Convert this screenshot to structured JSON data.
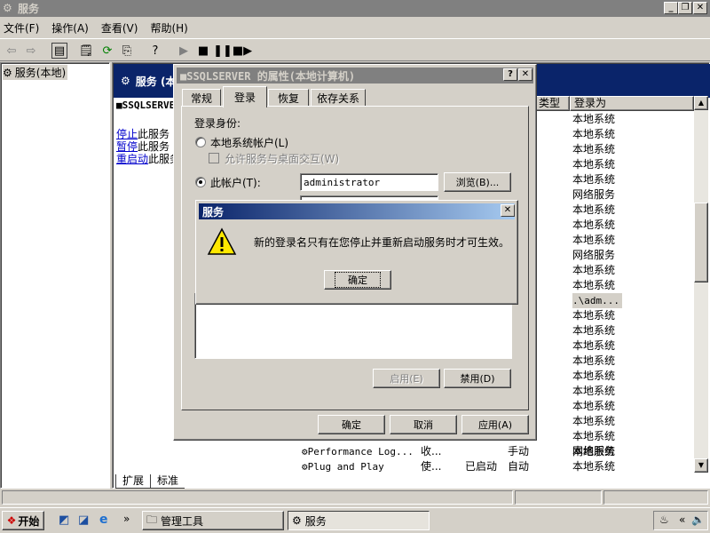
{
  "window": {
    "title": "服务"
  },
  "menu": [
    "文件(F)",
    "操作(A)",
    "查看(V)",
    "帮助(H)"
  ],
  "tree": {
    "root": "服务(本地)"
  },
  "services_header": {
    "title": "服务 (本地)"
  },
  "left_info": {
    "service_name": "■SSQLSERVER",
    "stop_link": "停止",
    "stop_rest": "此服务",
    "pause_link": "暂停",
    "pause_rest": "此服务",
    "restart_link": "重启动",
    "restart_rest": "此服务"
  },
  "columns": {
    "type": "类型",
    "logon": "登录为"
  },
  "logon_values": [
    "本地系统",
    "本地系统",
    "本地系统",
    "本地系统",
    "本地系统",
    "网络服务",
    "本地系统",
    "本地系统",
    "本地系统",
    "网络服务",
    "本地系统",
    "本地系统",
    ".\\adm...",
    "本地系统",
    "本地系统",
    "本地系统",
    "本地系统",
    "本地系统",
    "本地系统",
    "本地系统",
    "本地系统",
    "本地系统",
    "本地系统"
  ],
  "bottom_rows": [
    {
      "name": "Performance Log...",
      "desc": "收...",
      "status": "",
      "type": "手动",
      "logon": "网络服务"
    },
    {
      "name": "Plug and Play",
      "desc": "使...",
      "status": "已启动",
      "type": "自动",
      "logon": "本地系统"
    }
  ],
  "view_tabs": [
    "扩展",
    "标准"
  ],
  "taskbar": {
    "start": "开始",
    "task1": "管理工具",
    "task2": "服务"
  },
  "prop_dialog": {
    "title": "■SSQLSERVER 的属性(本地计算机)",
    "tabs": [
      "常规",
      "登录",
      "恢复",
      "依存关系"
    ],
    "group_label": "登录身份:",
    "local_system": "本地系统帐户(L)",
    "allow_desktop": "允许服务与桌面交互(W)",
    "this_account": "此帐户(T):",
    "account_value": "administrator",
    "browse": "浏览(B)...",
    "enable": "启用(E)",
    "disable": "禁用(D)",
    "ok": "确定",
    "cancel": "取消",
    "apply": "应用(A)"
  },
  "msg_dialog": {
    "title": "服务",
    "message": "新的登录名只有在您停止并重新启动服务时才可生效。",
    "ok": "确定"
  }
}
